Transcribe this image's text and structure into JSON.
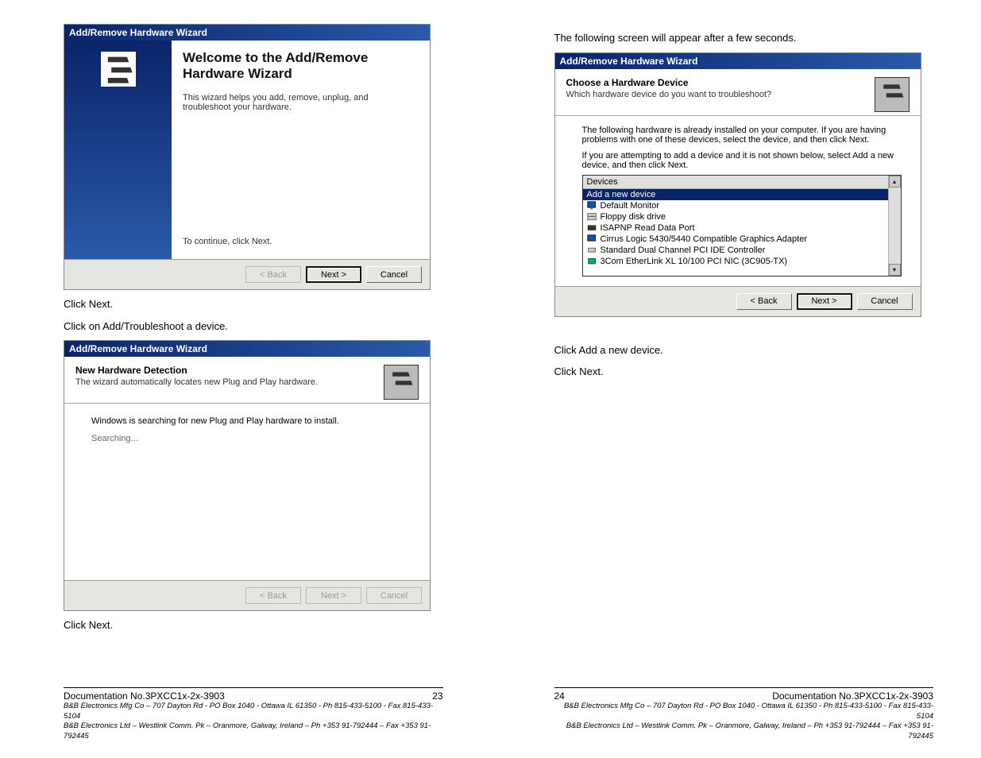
{
  "left": {
    "dlg1": {
      "title": "Add/Remove Hardware Wizard",
      "heading": "Welcome to the Add/Remove Hardware Wizard",
      "desc": "This wizard helps you add, remove, unplug, and troubleshoot your hardware.",
      "continue": "To continue, click Next.",
      "back": "< Back",
      "next": "Next >",
      "cancel": "Cancel"
    },
    "instr1": "Click Next.",
    "instr2": "Click on Add/Troubleshoot a device.",
    "dlg2": {
      "title": "Add/Remove Hardware Wizard",
      "heading": "New Hardware Detection",
      "sub": "The wizard automatically locates new Plug and Play hardware.",
      "body": "Windows is searching for new Plug and Play hardware to install.",
      "searching": "Searching...",
      "back": "< Back",
      "next": "Next >",
      "cancel": "Cancel"
    },
    "instr3": "Click Next.",
    "footer": {
      "docnum": "Documentation No.3PXCC1x-2x-3903",
      "pagenum": "23",
      "line1": "B&B Electronics Mfg Co – 707 Dayton Rd - PO Box 1040 - Ottawa IL 61350 - Ph 815-433-5100 - Fax 815-433-5104",
      "line2": "B&B Electronics Ltd – Westlink Comm. Pk – Oranmore, Galway, Ireland – Ph +353 91-792444 – Fax +353 91-792445"
    }
  },
  "right": {
    "intro": "The following screen will appear after a few seconds.",
    "dlg": {
      "title": "Add/Remove Hardware Wizard",
      "heading": "Choose a Hardware Device",
      "sub": "Which hardware device do you want to troubleshoot?",
      "para1": "The following hardware is already installed on your computer. If you are having problems with one of these devices, select the device, and then click Next.",
      "para2": "If you are attempting to add a device and it is not shown below, select Add a new device, and then click Next.",
      "listhead": "Devices",
      "items": [
        "Add a new device",
        "Default Monitor",
        "Floppy disk drive",
        "ISAPNP Read Data Port",
        "Cirrus Logic 5430/5440 Compatible Graphics Adapter",
        "Standard Dual Channel PCI IDE Controller",
        "3Com EtherLink XL 10/100 PCI NIC (3C905-TX)"
      ],
      "back": "< Back",
      "next": "Next >",
      "cancel": "Cancel"
    },
    "instr1": "Click Add a new device.",
    "instr2": "Click Next.",
    "footer": {
      "pagenum": "24",
      "docnum": "Documentation No.3PXCC1x-2x-3903",
      "line1": "B&B Electronics Mfg Co – 707 Dayton Rd - PO Box 1040 - Ottawa IL 61350 - Ph 815-433-5100 - Fax 815-433-5104",
      "line2": "B&B Electronics Ltd – Westlink Comm. Pk – Oranmore, Galway, Ireland – Ph +353 91-792444 – Fax +353 91-792445"
    }
  }
}
